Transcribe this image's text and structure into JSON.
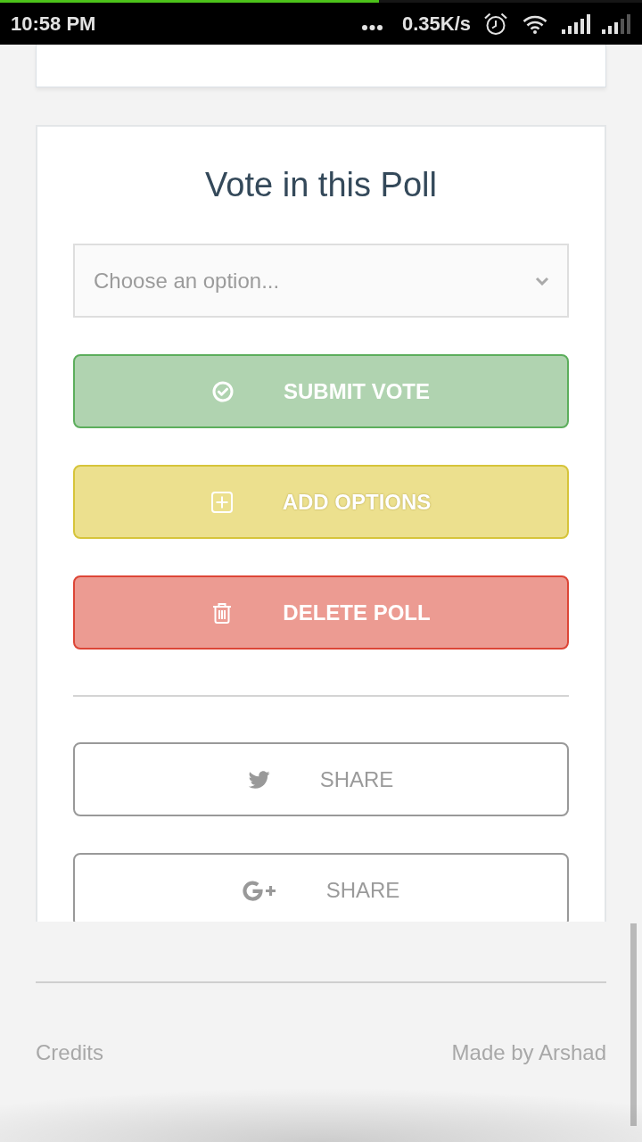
{
  "status_bar": {
    "time": "10:58 PM",
    "net_speed": "0.35K/s",
    "load_progress": {
      "level": 0.59
    }
  },
  "poll": {
    "title": "Vote in this Poll",
    "select": {
      "placeholder": "Choose an option..."
    },
    "actions": [
      {
        "kind": "submit",
        "label": "SUBMIT VOTE"
      },
      {
        "kind": "add",
        "label": "ADD OPTIONS"
      },
      {
        "kind": "delete",
        "label": "DELETE POLL"
      }
    ],
    "shares": [
      {
        "kind": "twitter",
        "label": "SHARE"
      },
      {
        "kind": "googleplus",
        "label": "SHARE"
      }
    ]
  },
  "footer": {
    "credits": "Credits",
    "author": "Made by Arshad"
  }
}
